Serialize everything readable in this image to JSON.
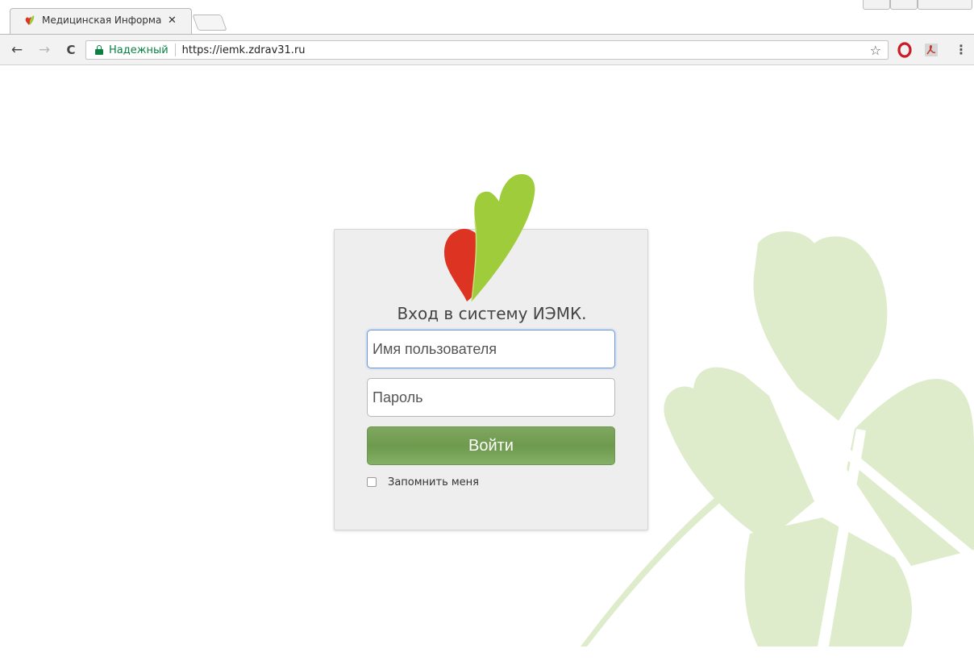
{
  "browser": {
    "tab": {
      "title": "Медицинская Информа",
      "close_glyph": "✕"
    },
    "nav": {
      "back_glyph": "←",
      "forward_glyph": "→",
      "reload_glyph": "C"
    },
    "omnibox": {
      "secure_label": "Надежный",
      "url": "https://iemk.zdrav31.ru"
    },
    "icons": [
      "heart-leaf-favicon-icon",
      "lock-icon",
      "star-icon",
      "opera-icon",
      "pdf-icon",
      "menu-icon"
    ],
    "star_glyph": "☆",
    "menu_glyph": "⋮"
  },
  "login": {
    "title": "Вход в систему ИЭМК.",
    "username_placeholder": "Имя пользователя",
    "password_placeholder": "Пароль",
    "submit_label": "Войти",
    "remember_label": "Запомнить меня",
    "remember_checked": false
  },
  "colors": {
    "secure_green": "#0b8043",
    "button_green": "#76a257",
    "leaf_green": "#9fcc3b",
    "heart_red": "#dd3322",
    "clover_bg": "#deeccc"
  }
}
